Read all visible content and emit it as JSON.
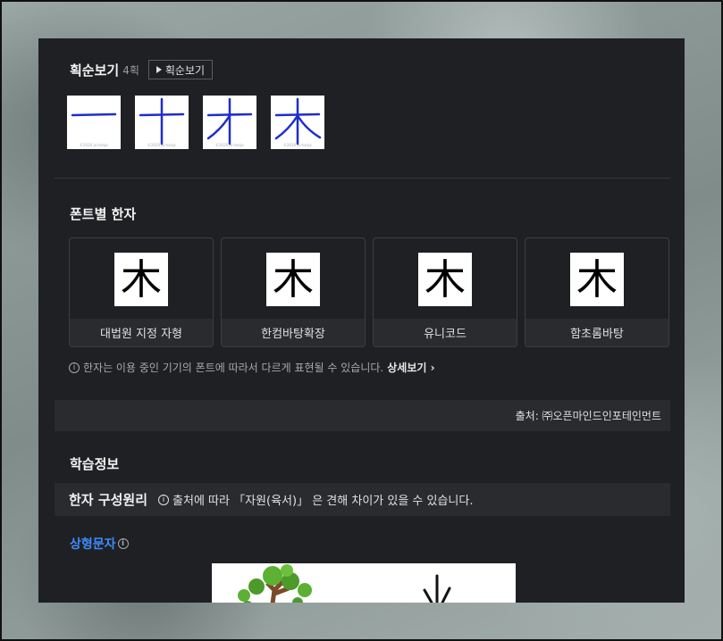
{
  "stroke_order": {
    "title": "획순보기",
    "count": "4획",
    "play_label": "획순보기",
    "frames": [
      {
        "copyright": "©2020 jo-hanja"
      },
      {
        "copyright": "©2020 jo-hanja"
      },
      {
        "copyright": "©2020 jo-hanja"
      },
      {
        "copyright": "©2020 jo-hanja"
      }
    ]
  },
  "fonts": {
    "title": "폰트별 한자",
    "character": "木",
    "cards": [
      {
        "name": "대법원 지정 자형"
      },
      {
        "name": "한컴바탕확장"
      },
      {
        "name": "유니코드"
      },
      {
        "name": "함초롬바탕"
      }
    ],
    "note": "한자는 이용 중인 기기의 폰트에 따라서 다르게 표현될 수 있습니다.",
    "detail_link": "상세보기 ›"
  },
  "source": "출처: ㈜오픈마인드인포테인먼트",
  "learning": {
    "title": "학습정보",
    "principle_title": "한자 구성원리",
    "principle_note": "출처에 따라 「자원(육서)」 은 견해 차이가 있을 수 있습니다.",
    "pictograph_label": "상형문자"
  },
  "colors": {
    "panel_bg": "#1f2023",
    "stroke_blue": "#1e2ec8",
    "link_blue": "#3d8bff"
  }
}
